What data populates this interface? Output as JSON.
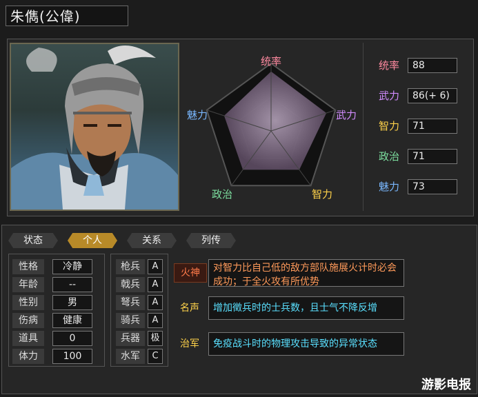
{
  "general": {
    "name": "朱儁(公偉)"
  },
  "radar": {
    "labels": {
      "command": "统率",
      "force": "武力",
      "intelligence": "智力",
      "politics": "政治",
      "charisma": "魅力"
    },
    "values": [
      88,
      86,
      71,
      71,
      73
    ],
    "max": 100
  },
  "stats": [
    {
      "label": "统率",
      "value": "88",
      "color": "#ff8aa0"
    },
    {
      "label": "武力",
      "value": "86(+ 6)",
      "color": "#d28cff"
    },
    {
      "label": "智力",
      "value": "71",
      "color": "#ffd24a"
    },
    {
      "label": "政治",
      "value": "71",
      "color": "#7de0a0"
    },
    {
      "label": "魅力",
      "value": "73",
      "color": "#7ab8ff"
    }
  ],
  "tabs": [
    {
      "label": "状态",
      "active": false
    },
    {
      "label": "个人",
      "active": true
    },
    {
      "label": "关系",
      "active": false
    },
    {
      "label": "列传",
      "active": false
    }
  ],
  "attributes": [
    {
      "label": "性格",
      "value": "冷静"
    },
    {
      "label": "年龄",
      "value": "--"
    },
    {
      "label": "性别",
      "value": "男"
    },
    {
      "label": "伤病",
      "value": "健康"
    },
    {
      "label": "道具",
      "value": "0"
    },
    {
      "label": "体力",
      "value": "100"
    }
  ],
  "troops": [
    {
      "label": "枪兵",
      "value": "A"
    },
    {
      "label": "戟兵",
      "value": "A"
    },
    {
      "label": "弩兵",
      "value": "A"
    },
    {
      "label": "骑兵",
      "value": "A"
    },
    {
      "label": "兵器",
      "value": "极"
    },
    {
      "label": "水军",
      "value": "C"
    }
  ],
  "skills": [
    {
      "name": "火神",
      "desc": "对智力比自己低的敌方部队施展火计时必会成功；于全火攻有所优势",
      "name_color": "#ff7a4a",
      "desc_color": "#ff9a5a"
    },
    {
      "name": "名声",
      "desc": "增加徵兵时的士兵数，且士气不降反增",
      "name_color": "#ffd24a",
      "desc_color": "#5ae0ff"
    },
    {
      "name": "治军",
      "desc": "免疫战斗时的物理攻击导致的异常状态",
      "name_color": "#ffd24a",
      "desc_color": "#5ae0ff"
    }
  ],
  "watermark": "游影电报"
}
